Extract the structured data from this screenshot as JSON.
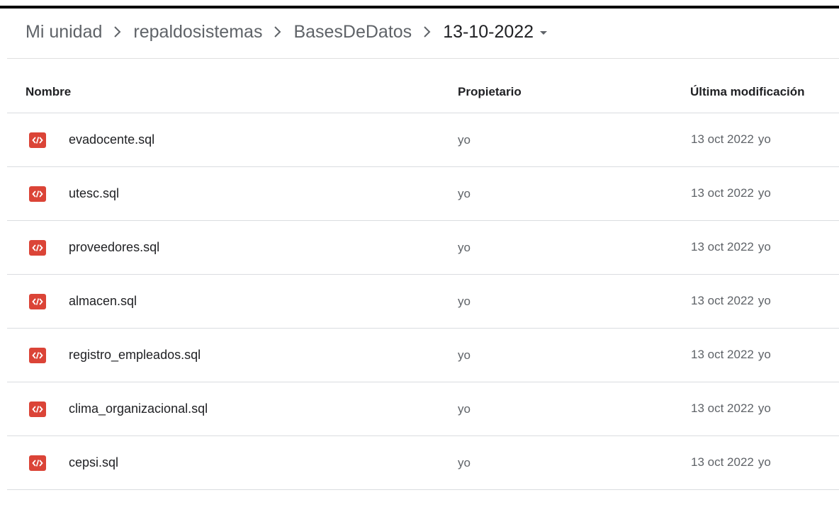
{
  "breadcrumb": {
    "items": [
      "Mi unidad",
      "repaldosistemas",
      "BasesDeDatos"
    ],
    "current": "13-10-2022"
  },
  "table": {
    "headers": {
      "name": "Nombre",
      "owner": "Propietario",
      "modified": "Última modificación"
    },
    "rows": [
      {
        "name": "evadocente.sql",
        "owner": "yo",
        "date": "13 oct 2022",
        "by": "yo",
        "icon": "sql-code-file-icon"
      },
      {
        "name": "utesc.sql",
        "owner": "yo",
        "date": "13 oct 2022",
        "by": "yo",
        "icon": "sql-code-file-icon"
      },
      {
        "name": "proveedores.sql",
        "owner": "yo",
        "date": "13 oct 2022",
        "by": "yo",
        "icon": "sql-code-file-icon"
      },
      {
        "name": "almacen.sql",
        "owner": "yo",
        "date": "13 oct 2022",
        "by": "yo",
        "icon": "sql-code-file-icon"
      },
      {
        "name": "registro_empleados.sql",
        "owner": "yo",
        "date": "13 oct 2022",
        "by": "yo",
        "icon": "sql-code-file-icon"
      },
      {
        "name": "clima_organizacional.sql",
        "owner": "yo",
        "date": "13 oct 2022",
        "by": "yo",
        "icon": "sql-code-file-icon"
      },
      {
        "name": "cepsi.sql",
        "owner": "yo",
        "date": "13 oct 2022",
        "by": "yo",
        "icon": "sql-code-file-icon"
      }
    ]
  },
  "colors": {
    "file_icon": "#db4437",
    "text_primary": "#202124",
    "text_secondary": "#5f6368",
    "divider": "#dadce0"
  }
}
